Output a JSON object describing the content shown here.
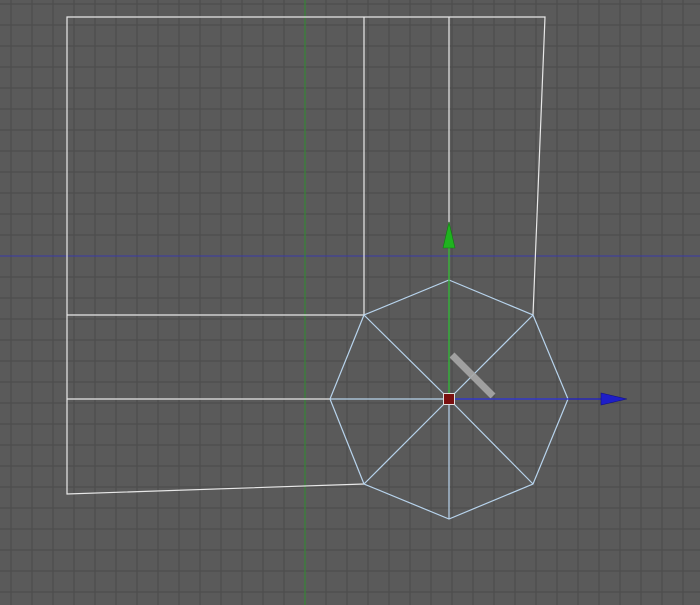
{
  "viewport": {
    "view": "top-orthographic",
    "background_color": "#5a5a5a",
    "grid_line_color": "#4b4b4b",
    "grid_visible": true,
    "world_axis_x_color": "#3a3aa8",
    "world_axis_y_color": "#2f8f2f",
    "wireframe_color": "#e8e8e8",
    "selected_wireframe_color": "#b7d3ec"
  },
  "gizmo": {
    "type": "move",
    "x_axis_color": "#1e1ec8",
    "y_axis_color": "#1fb31f",
    "pivot_color": "#7a1010",
    "handle_color": "#a8a8a8"
  },
  "mesh": {
    "name": "",
    "selected_part": "octagon-cap",
    "segments": 8
  }
}
